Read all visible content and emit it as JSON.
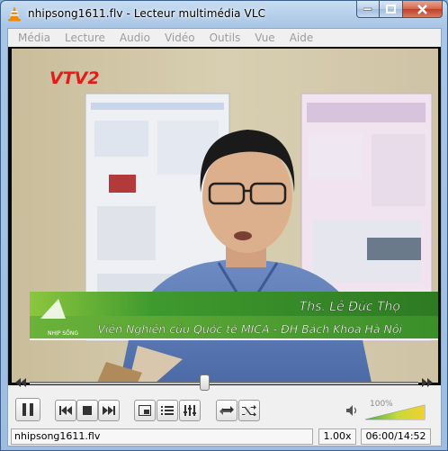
{
  "window": {
    "title": "nhipsong1611.flv - Lecteur multimédia VLC"
  },
  "menu": {
    "items": [
      "Média",
      "Lecture",
      "Audio",
      "Vidéo",
      "Outils",
      "Vue",
      "Aide"
    ]
  },
  "video": {
    "channel_logo": "VTV2",
    "lower_third_name": "Ths. Lê Đức Thọ",
    "lower_third_affiliation": "Viện Nghiên cứu Quốc tế MICA - ĐH Bách Khoa Hà Nội",
    "logo_text": "NHỊP SỐNG"
  },
  "playback": {
    "seek_fraction": 0.45
  },
  "controls": {
    "volume_percent_label": "100%",
    "volume_level": 1.0
  },
  "status": {
    "filename": "nhipsong1611.flv",
    "speed": "1.00x",
    "time": "06:00/14:52"
  },
  "colors": {
    "accent_orange": "#f28a00",
    "lower_third_green": "#3a8f2a"
  }
}
